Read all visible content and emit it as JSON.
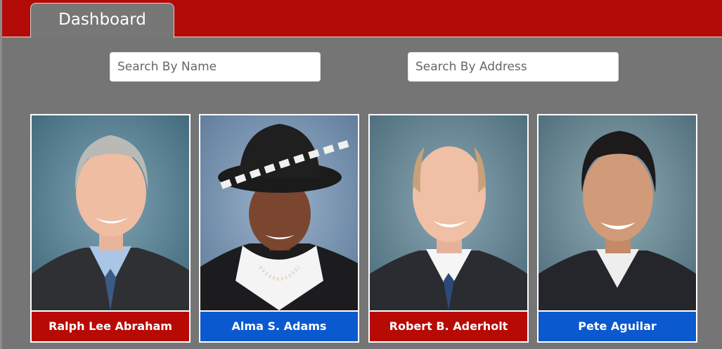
{
  "header": {
    "tab_label": "Dashboard",
    "bar_color": "#b30b07"
  },
  "search": {
    "name_placeholder": "Search By Name",
    "address_placeholder": "Search By Address"
  },
  "party_colors": {
    "republican": "#b80a05",
    "democrat": "#0a59cf"
  },
  "members": [
    {
      "name": "Ralph Lee Abraham",
      "party": "republican"
    },
    {
      "name": "Alma S. Adams",
      "party": "democrat"
    },
    {
      "name": "Robert B. Aderholt",
      "party": "republican"
    },
    {
      "name": "Pete Aguilar",
      "party": "democrat"
    }
  ]
}
